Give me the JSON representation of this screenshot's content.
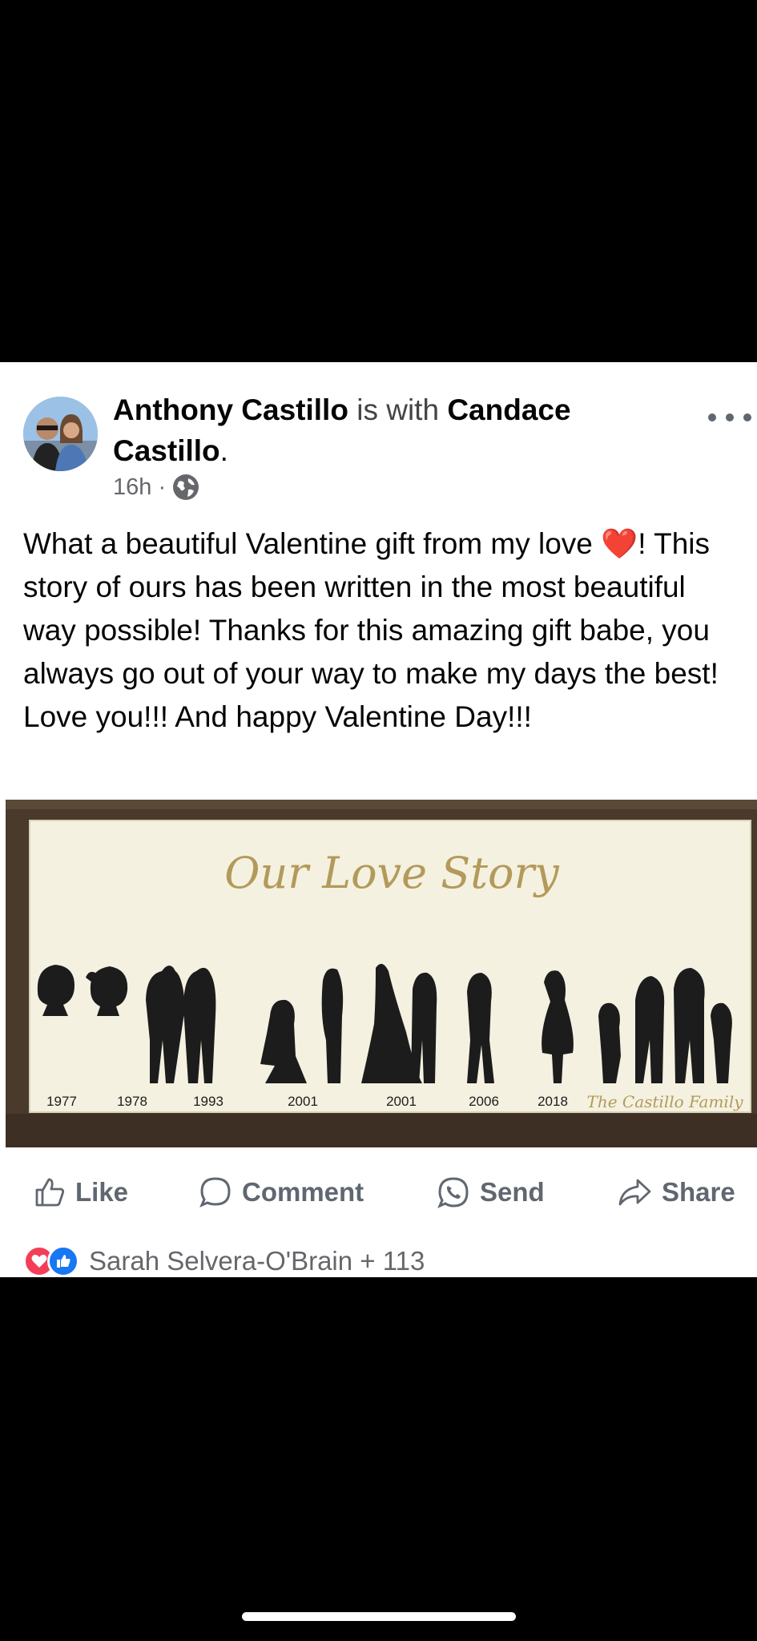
{
  "post": {
    "author": "Anthony Castillo",
    "with_word": "is with",
    "tagged_first": "Candace",
    "tagged_last": "Castillo",
    "period": ".",
    "time": "16h ·",
    "privacy_icon": "globe-icon",
    "more_icon": "more-options-icon",
    "caption": "What a beautiful Valentine gift from my love ❤️! This story of ours has been written in the most beautiful way possible! Thanks for this amazing gift babe, you always go out of your way to make my days the best! Love you!!! And happy Valentine Day!!!"
  },
  "photo": {
    "title": "Our Love Story",
    "years": [
      "1977",
      "1978",
      "1993",
      "2001",
      "2001",
      "2006",
      "2018"
    ],
    "family_label": "The Castillo Family"
  },
  "actions": {
    "like": "Like",
    "comment": "Comment",
    "send": "Send",
    "share": "Share"
  },
  "reactions": {
    "summary": "Sarah Selvera-O'Brain + 113",
    "icons": [
      "love-reaction-icon",
      "like-reaction-icon"
    ]
  },
  "colors": {
    "accent": "#1877f2",
    "love": "#f33e58",
    "frame": "#4a3a2c",
    "board": "#f4f1e1",
    "gold": "#b39a5a"
  }
}
